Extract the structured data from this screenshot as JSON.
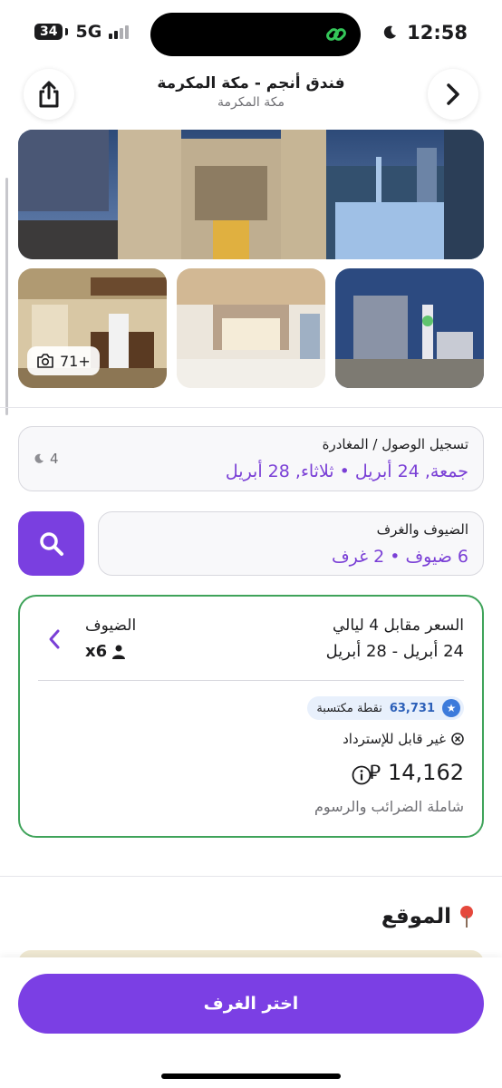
{
  "status_bar": {
    "battery": "34",
    "network": "5G",
    "time": "12:58"
  },
  "header": {
    "title": "فندق أنجم - مكة المكرمة",
    "subtitle": "مكة المكرمة"
  },
  "gallery": {
    "photo_count": "71+"
  },
  "dates": {
    "label": "تسجيل الوصول / المغادرة",
    "value": "جمعة, 24 أبريل • ثلاثاء, 28 أبريل",
    "nights": "4"
  },
  "guests": {
    "label": "الضيوف والغرف",
    "value": "6 ضيوف • 2 غرف"
  },
  "price_card": {
    "price_label": "السعر مقابل 4 ليالي",
    "date_range": "24 أبريل - 28 أبريل",
    "guests_label": "الضيوف",
    "guests_value": "x6",
    "points_value": "63,731",
    "points_label": "نقطة مكتسبة",
    "refund_text": "غير قابل للإسترداد",
    "price": "14,162",
    "currency": "⃁",
    "tax_note": "شاملة الضرائب والرسوم"
  },
  "location": {
    "title": "الموقع"
  },
  "cta": {
    "label": "اختر الغرف"
  },
  "colors": {
    "accent": "#7b3fe4",
    "card_border": "#3fa35a",
    "points": "#3d7bdb"
  }
}
